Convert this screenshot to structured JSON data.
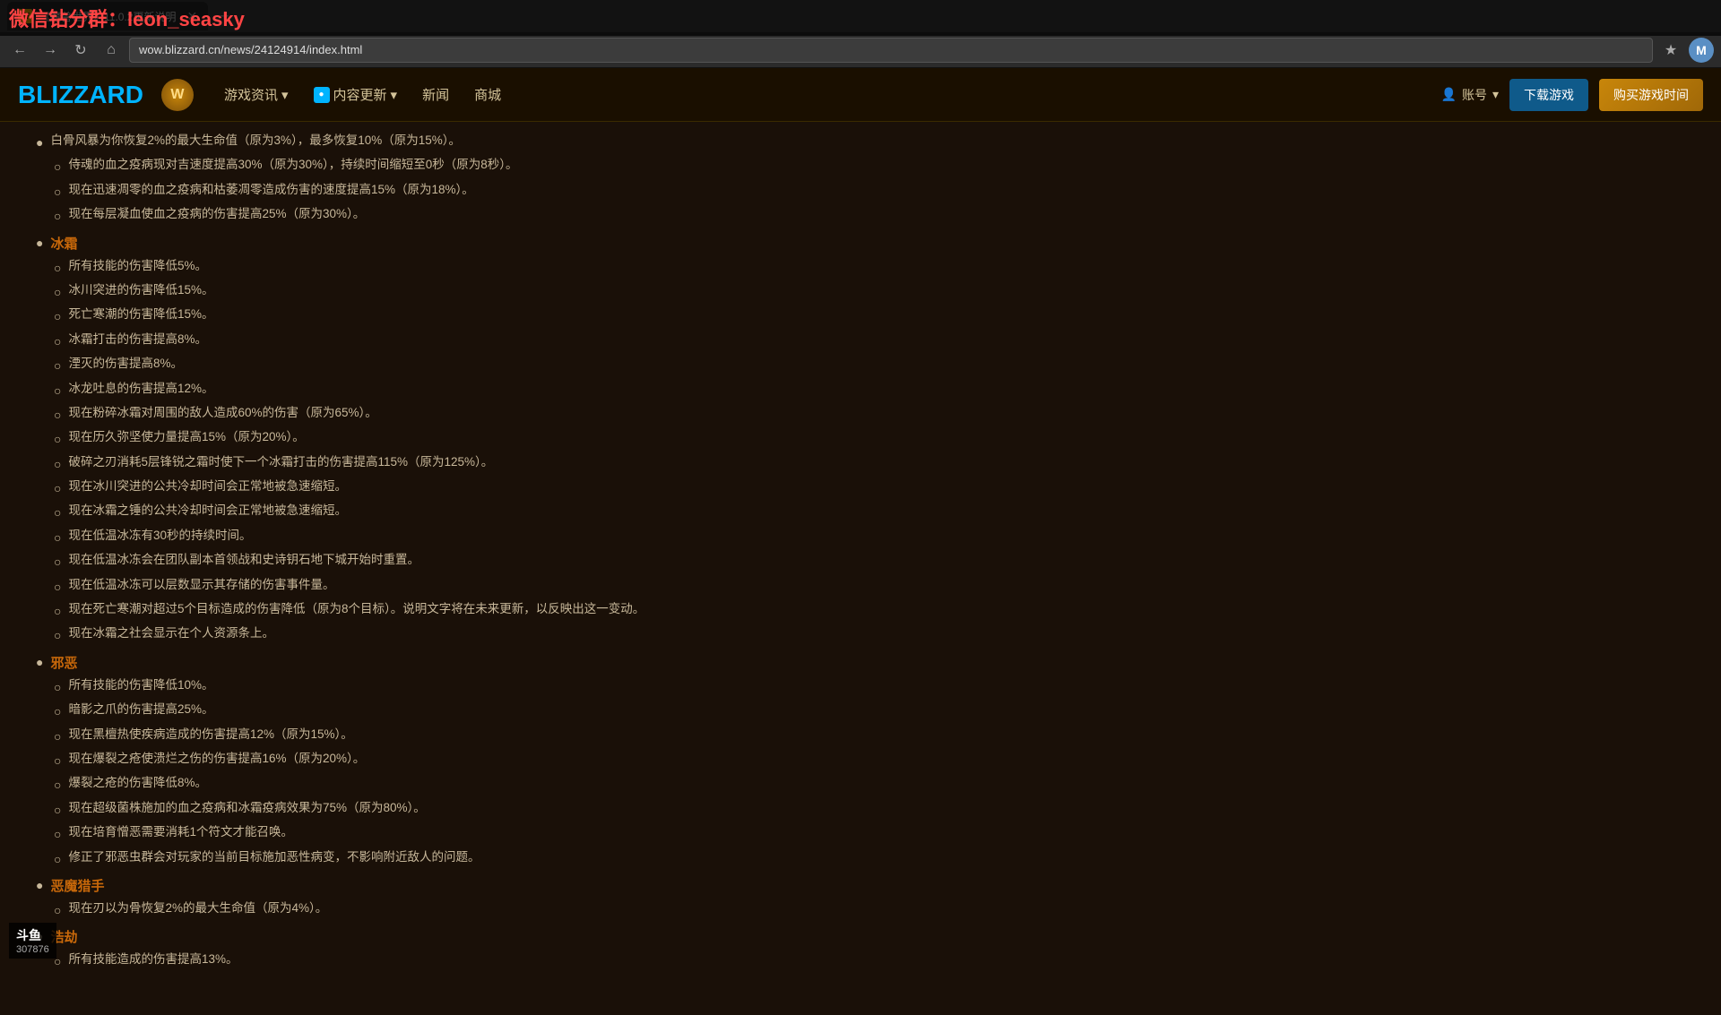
{
  "browser": {
    "tab_label": "《魔兽世界》11.0.2更新说明",
    "tab_favicon": "W",
    "url": "wow.blizzard.cn/news/24124914/index.html",
    "new_tab_label": "+",
    "back_label": "←",
    "forward_label": "→",
    "refresh_label": "↻",
    "home_label": "⌂",
    "bookmark_label": "★",
    "profile_label": "M"
  },
  "watermark": {
    "text": "微信钻分群：leon_seasky"
  },
  "site_header": {
    "logo": "BLIZZARD",
    "wow_icon": "W",
    "nav_items": [
      {
        "label": "游戏资讯",
        "has_dropdown": true
      },
      {
        "label": "内容更新",
        "has_dropdown": true,
        "has_icon": true
      },
      {
        "label": "新闻"
      },
      {
        "label": "商城"
      }
    ],
    "account_label": "账号",
    "download_label": "下载游戏",
    "buy_label": "购买游戏时间"
  },
  "content": {
    "top_item": "白骨风暴为你恢复2%的最大生命值（原为3%），最多恢复10%（原为15%）。",
    "sections": [
      {
        "id": "blood",
        "title_visible": false,
        "items": [
          "侍魂的血之疫病现对吉速度提高30%（原为30%），持续时间缩短至0秒（原为8秒）。",
          "现在迅速凋零的血之疫病和枯萎凋零造成伤害的速度提高15%（原为18%）。",
          "现在每层凝血使血之疫病的伤害提高25%（原为30%）。"
        ]
      },
      {
        "id": "frost",
        "title": "冰霜",
        "items": [
          "所有技能的伤害降低5%。",
          "冰川突进的伤害降低15%。",
          "死亡寒潮的伤害降低15%。",
          "冰霜打击的伤害提高8%。",
          "湮灭的伤害提高8%。",
          "冰龙吐息的伤害提高12%。",
          "现在粉碎冰霜对周围的敌人造成60%的伤害（原为65%）。",
          "现在历久弥坚使力量提高15%（原为20%）。",
          "破碎之刃消耗5层锋锐之霜时使下一个冰霜打击的伤害提高115%（原为125%）。",
          "现在冰川突进的公共冷却时间会正常地被急速缩短。",
          "现在冰霜之锤的公共冷却时间会正常地被急速缩短。",
          "现在低温冰冻有30秒的持续时间。",
          "现在低温冰冻会在团队副本首领战和史诗钥石地下城开始时重置。",
          "现在低温冰冻可以层数显示其存储的伤害事件量。",
          "现在死亡寒潮对超过5个目标造成的伤害降低（原为8个目标）。说明文字将在未来更新，以反映出这一变动。",
          "现在冰霜之社会显示在个人资源条上。"
        ]
      },
      {
        "id": "unholy",
        "title": "邪恶",
        "items": [
          "所有技能的伤害降低10%。",
          "暗影之爪的伤害提高25%。",
          "现在黑檀热使疾病造成的伤害提高12%（原为15%）。",
          "现在爆裂之疮使溃烂之伤的伤害提高16%（原为20%）。",
          "爆裂之疮的伤害降低8%。",
          "现在超级菌株施加的血之疫病和冰霜疫病效果为75%（原为80%）。",
          "现在培育憎恶需要消耗1个符文才能召唤。",
          "修正了邪恶虫群会对玩家的当前目标施加恶性病变，不影响附近敌人的问题。"
        ]
      },
      {
        "id": "demon_hunter",
        "title": "恶魔猎手",
        "is_main": true,
        "items": [
          "现在刃以为骨恢复2%的最大生命值（原为4%）。"
        ]
      },
      {
        "id": "havoc",
        "title": "浩劫",
        "items": [
          "所有技能造成的伤害提高13%。"
        ]
      }
    ]
  },
  "corner_overlay": {
    "game_name": "斗鱼",
    "game_id": "307876"
  }
}
